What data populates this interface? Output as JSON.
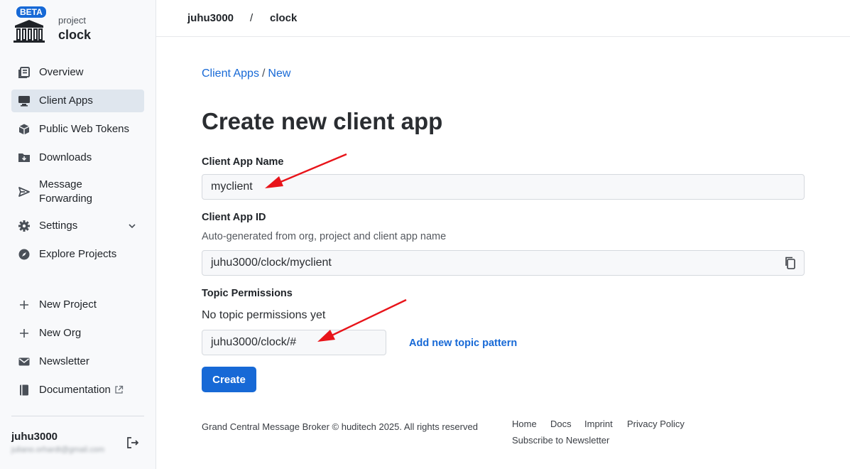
{
  "brand": {
    "badge": "BETA",
    "sub": "project",
    "name": "clock"
  },
  "sidebar": {
    "items": [
      {
        "label": "Overview",
        "icon": "overview-icon"
      },
      {
        "label": "Client Apps",
        "icon": "monitor-icon",
        "active": true
      },
      {
        "label": "Public Web Tokens",
        "icon": "cube-icon"
      },
      {
        "label": "Downloads",
        "icon": "folder-download-icon"
      },
      {
        "label": "Message Forwarding",
        "label_line1": "Message",
        "label_line2": "Forwarding",
        "icon": "send-icon"
      },
      {
        "label": "Settings",
        "icon": "gear-icon"
      },
      {
        "label": "Explore Projects",
        "icon": "compass-icon"
      },
      {
        "label": "New Project",
        "icon": "plus-icon"
      },
      {
        "label": "New Org",
        "icon": "plus-icon"
      },
      {
        "label": "Newsletter",
        "icon": "mail-icon"
      },
      {
        "label": "Documentation",
        "icon": "book-icon"
      }
    ],
    "user": {
      "name": "juhu3000",
      "email": "juliano.orhardt@gmail.com"
    }
  },
  "topbar": {
    "org": "juhu3000",
    "sep": "/",
    "project": "clock"
  },
  "breadcrumb": {
    "parent": "Client Apps",
    "sep": "/",
    "current": "New"
  },
  "page": {
    "title": "Create new client app",
    "name_label": "Client App Name",
    "name_value": "myclient",
    "id_label": "Client App ID",
    "id_help": "Auto-generated from org, project and client app name",
    "id_value": "juhu3000/clock/myclient",
    "topic_label": "Topic Permissions",
    "topic_empty": "No topic permissions yet",
    "topic_value": "juhu3000/clock/#",
    "add_topic": "Add new topic pattern",
    "create": "Create"
  },
  "footer": {
    "copyright": "Grand Central Message Broker © huditech 2025. All rights reserved",
    "links": [
      "Home",
      "Docs",
      "Imprint",
      "Privacy Policy",
      "Subscribe to Newsletter"
    ]
  },
  "colors": {
    "accent": "#1769d6",
    "annotation_arrow": "#e8141a",
    "active_nav": "#dfe6ee"
  }
}
